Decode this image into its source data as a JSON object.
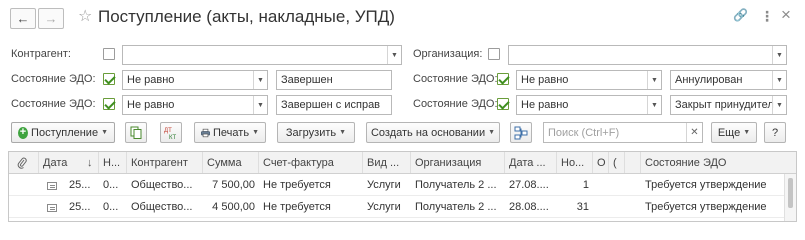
{
  "window": {
    "title": "Поступление (акты, накладные, УПД)",
    "back_icon": "←",
    "forward_icon": "→",
    "star_icon": "☆",
    "link_icon": "🔗",
    "more_icon": "⋮",
    "close_icon": "×"
  },
  "filters": {
    "counterparty_label": "Контрагент:",
    "counterparty_value": "",
    "organization_label": "Организация:",
    "organization_value": "",
    "edo_rows": [
      {
        "label": "Состояние ЭДО:",
        "left_cond": "Не равно",
        "left_value": "Завершен",
        "right_label": "Состояние ЭДО:",
        "right_cond": "Не равно",
        "right_value": "Аннулирован"
      },
      {
        "label": "Состояние ЭДО:",
        "left_cond": "Не равно",
        "left_value": "Завершен с исправ",
        "right_label": "Состояние ЭДО:",
        "right_cond": "Не равно",
        "right_value": "Закрыт принудител"
      }
    ]
  },
  "toolbar": {
    "receipt_label": "Поступление",
    "print_label": "Печать",
    "load_label": "Загрузить",
    "create_based_label": "Создать на основании",
    "search_placeholder": "Поиск (Ctrl+F)",
    "more_label": "Еще",
    "help_label": "?"
  },
  "table": {
    "columns": [
      "Дата",
      "↓",
      "Н...",
      "Контрагент",
      "Сумма",
      "Счет-фактура",
      "Вид ...",
      "Организация",
      "Дата ...",
      "Но...",
      "О",
      "(",
      "Состояние ЭДО"
    ],
    "rows": [
      {
        "date": "25...",
        "num": "0...",
        "counterparty": "Общество...",
        "sum": "7 500,00",
        "invoice": "Не требуется",
        "kind": "Услуги",
        "org": "Получатель 2 ...",
        "date2": "27.08....",
        "number": "1",
        "edo_state": "Требуется утверждение"
      },
      {
        "date": "25...",
        "num": "0...",
        "counterparty": "Общество...",
        "sum": "4 500,00",
        "invoice": "Не требуется",
        "kind": "Услуги",
        "org": "Получатель 2 ...",
        "date2": "28.08....",
        "number": "31",
        "edo_state": "Требуется утверждение"
      }
    ]
  }
}
